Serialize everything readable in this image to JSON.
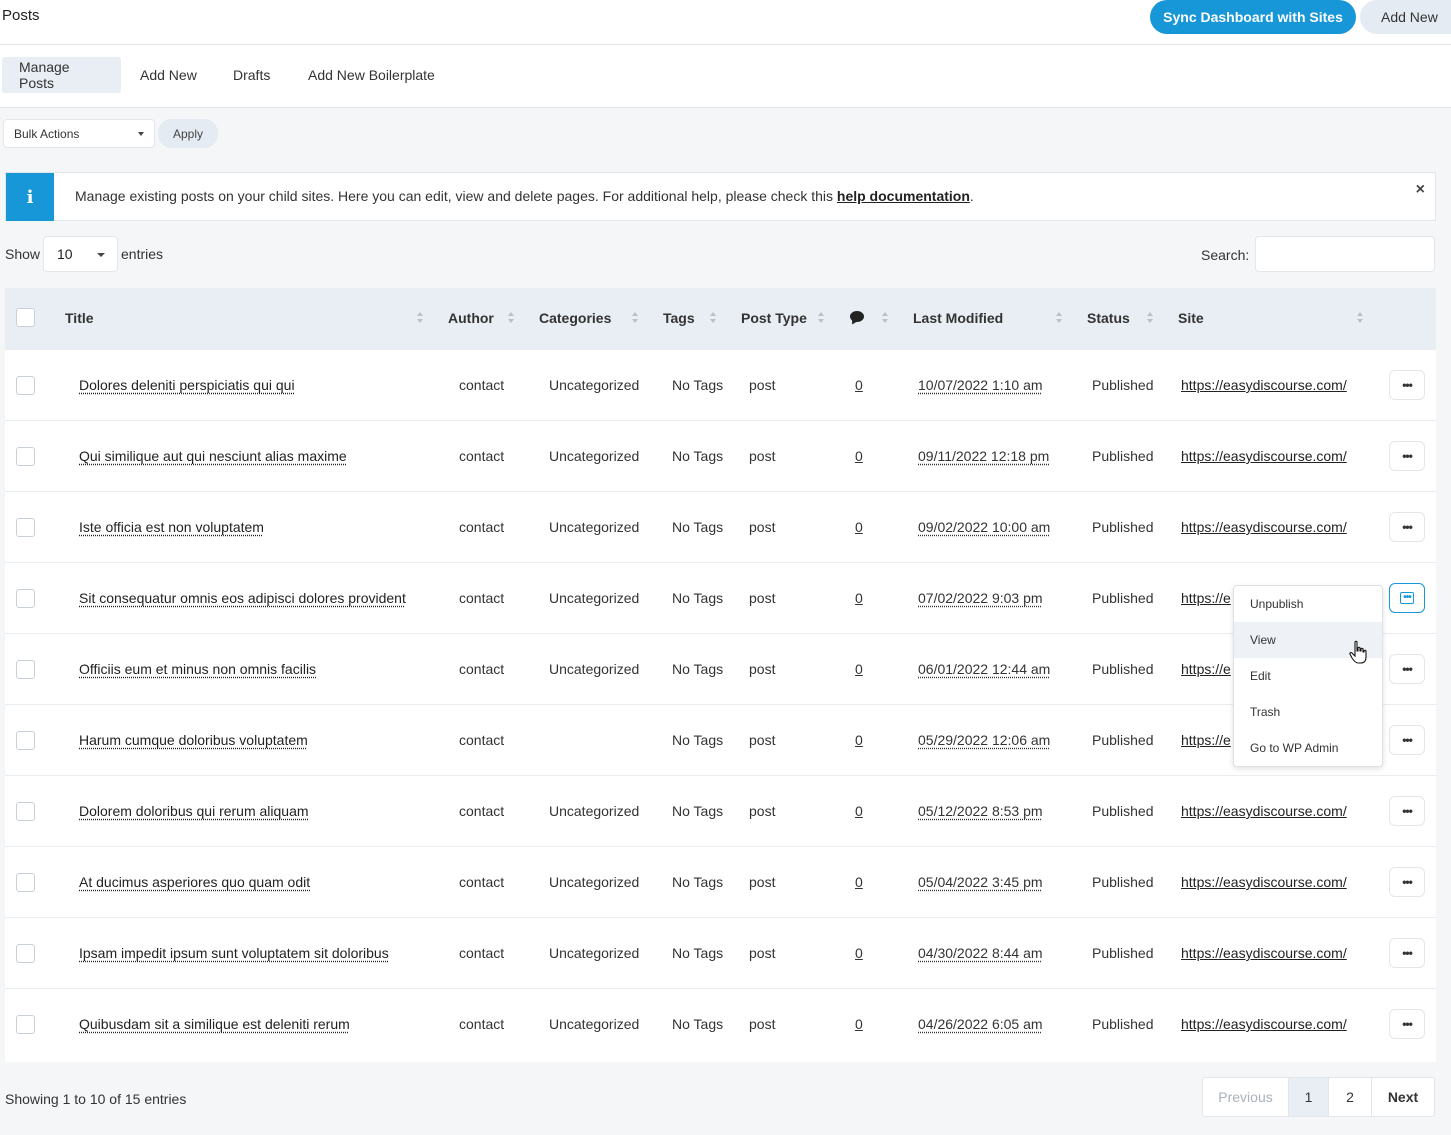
{
  "header": {
    "title": "Posts",
    "sync_label": "Sync Dashboard with Sites",
    "add_new_label": "Add New"
  },
  "tabs": [
    {
      "label": "Manage Posts",
      "active": true
    },
    {
      "label": "Add New"
    },
    {
      "label": "Drafts"
    },
    {
      "label": "Add New Boilerplate"
    }
  ],
  "bulk": {
    "selected": "Bulk Actions",
    "apply_label": "Apply"
  },
  "info": {
    "icon": "info-icon",
    "message": "Manage existing posts on your child sites. Here you can edit, view and delete pages. For additional help, please check this ",
    "link_text": "help documentation",
    "suffix": ".",
    "close_glyph": "×"
  },
  "length": {
    "show_label": "Show",
    "value": "10",
    "entries_label": "entries"
  },
  "search": {
    "label": "Search:",
    "value": ""
  },
  "columns": {
    "title": "Title",
    "author": "Author",
    "categories": "Categories",
    "tags": "Tags",
    "post_type": "Post Type",
    "comments_icon": "comment-icon",
    "last_modified": "Last Modified",
    "status": "Status",
    "site": "Site"
  },
  "rows": [
    {
      "title": "Dolores deleniti perspiciatis qui qui",
      "author": "contact",
      "categories": "Uncategorized",
      "tags": "No Tags",
      "post_type": "post",
      "comments": "0",
      "date": "10/07/2022 1:10 am",
      "status": "Published",
      "site": "https://easydiscourse.com/"
    },
    {
      "title": "Qui similique aut qui nesciunt alias maxime",
      "author": "contact",
      "categories": "Uncategorized",
      "tags": "No Tags",
      "post_type": "post",
      "comments": "0",
      "date": "09/11/2022 12:18 pm",
      "status": "Published",
      "site": "https://easydiscourse.com/"
    },
    {
      "title": "Iste officia est non voluptatem",
      "author": "contact",
      "categories": "Uncategorized",
      "tags": "No Tags",
      "post_type": "post",
      "comments": "0",
      "date": "09/02/2022 10:00 am",
      "status": "Published",
      "site": "https://easydiscourse.com/"
    },
    {
      "title": "Sit consequatur omnis eos adipisci dolores provident",
      "author": "contact",
      "categories": "Uncategorized",
      "tags": "No Tags",
      "post_type": "post",
      "comments": "0",
      "date": "07/02/2022 9:03 pm",
      "status": "Published",
      "site": "https://e"
    },
    {
      "title": "Officiis eum et minus non omnis facilis",
      "author": "contact",
      "categories": "Uncategorized",
      "tags": "No Tags",
      "post_type": "post",
      "comments": "0",
      "date": "06/01/2022 12:44 am",
      "status": "Published",
      "site": "https://e"
    },
    {
      "title": "Harum cumque doloribus voluptatem",
      "author": "contact",
      "categories": "",
      "tags": "No Tags",
      "post_type": "post",
      "comments": "0",
      "date": "05/29/2022 12:06 am",
      "status": "Published",
      "site": "https://e"
    },
    {
      "title": "Dolorem doloribus qui rerum aliquam",
      "author": "contact",
      "categories": "Uncategorized",
      "tags": "No Tags",
      "post_type": "post",
      "comments": "0",
      "date": "05/12/2022 8:53 pm",
      "status": "Published",
      "site": "https://easydiscourse.com/"
    },
    {
      "title": "At ducimus asperiores quo quam odit",
      "author": "contact",
      "categories": "Uncategorized",
      "tags": "No Tags",
      "post_type": "post",
      "comments": "0",
      "date": "05/04/2022 3:45 pm",
      "status": "Published",
      "site": "https://easydiscourse.com/"
    },
    {
      "title": "Ipsam impedit ipsum sunt voluptatem sit doloribus",
      "author": "contact",
      "categories": "Uncategorized",
      "tags": "No Tags",
      "post_type": "post",
      "comments": "0",
      "date": "04/30/2022 8:44 am",
      "status": "Published",
      "site": "https://easydiscourse.com/"
    },
    {
      "title": "Quibusdam sit a similique est deleniti rerum",
      "author": "contact",
      "categories": "Uncategorized",
      "tags": "No Tags",
      "post_type": "post",
      "comments": "0",
      "date": "04/26/2022 6:05 am",
      "status": "Published",
      "site": "https://easydiscourse.com/"
    }
  ],
  "row_menu": {
    "open_row": 4,
    "items": [
      "Unpublish",
      "View",
      "Edit",
      "Trash",
      "Go to WP Admin"
    ],
    "hovered": "View"
  },
  "footer": {
    "summary": "Showing 1 to 10 of 15 entries",
    "previous": "Previous",
    "pages": [
      "1",
      "2"
    ],
    "current_page": "1",
    "next": "Next"
  },
  "colors": {
    "accent": "#1797d8",
    "header_bg": "#e8eef4"
  }
}
